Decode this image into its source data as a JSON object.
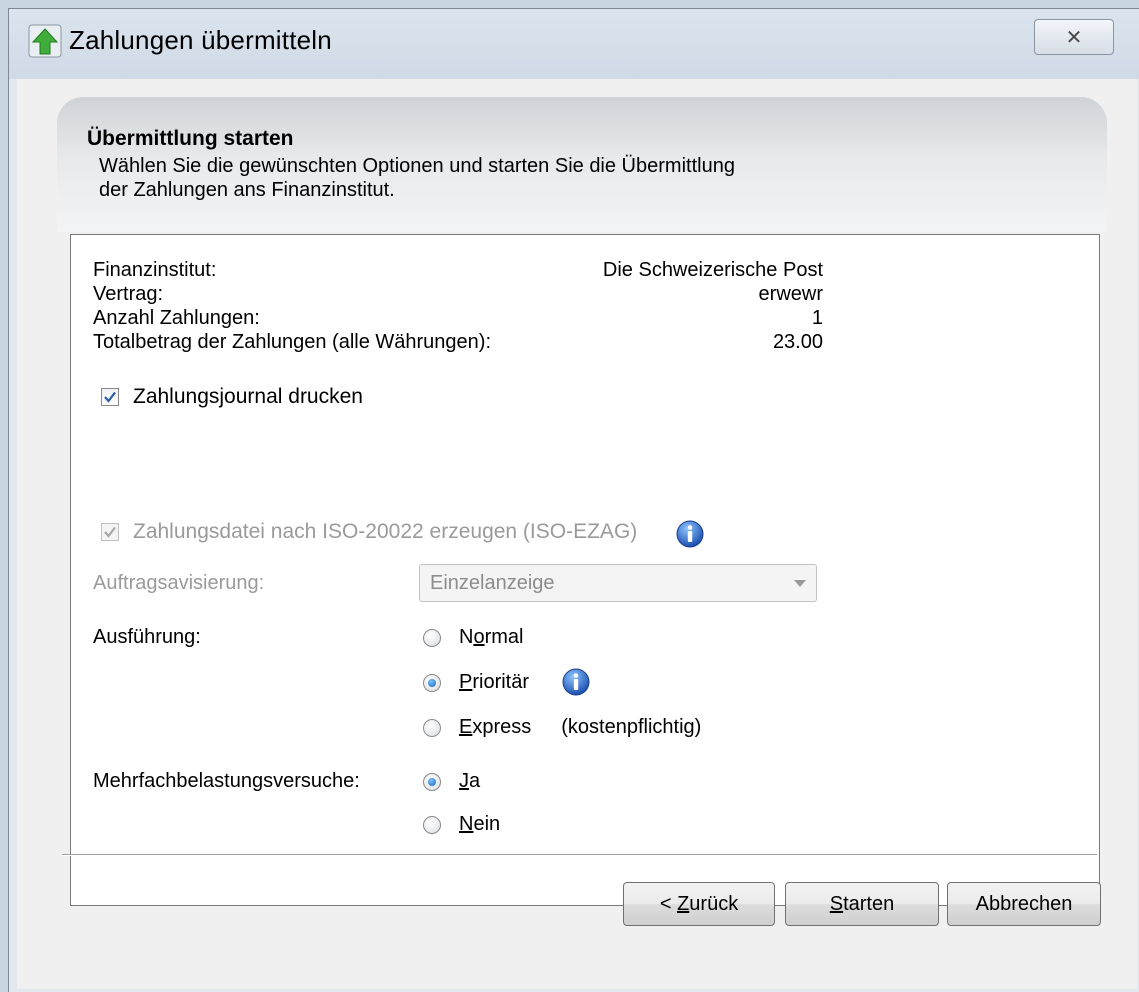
{
  "window": {
    "title": "Zahlungen übermitteln",
    "close_glyph": "✕"
  },
  "header": {
    "title": "Übermittlung starten",
    "description": "Wählen Sie die gewünschten Optionen und starten Sie die Übermittlung\nder Zahlungen ans Finanzinstitut."
  },
  "summary": [
    {
      "label": "Finanzinstitut:",
      "value": "Die Schweizerische Post"
    },
    {
      "label": "Vertrag:",
      "value": "erwewr"
    },
    {
      "label": "Anzahl Zahlungen:",
      "value": "1"
    },
    {
      "label": "Totalbetrag der Zahlungen (alle Währungen):",
      "value": "23.00"
    }
  ],
  "options": {
    "print_journal": {
      "label": "Zahlungsjournal drucken",
      "checked": true
    },
    "iso_file": {
      "label": "Zahlungsdatei nach ISO-20022 erzeugen (ISO-EZAG)",
      "checked": true,
      "enabled": false
    },
    "advice": {
      "label": "Auftragsavisierung:",
      "selected": "Einzelanzeige"
    }
  },
  "execution": {
    "label": "Ausführung:",
    "choices": [
      {
        "prefix": "N",
        "accel": "o",
        "rest": "rmal",
        "selected": false
      },
      {
        "prefix": "",
        "accel": "P",
        "rest": "rioritär",
        "selected": true
      },
      {
        "prefix": "",
        "accel": "E",
        "rest": "xpress",
        "note": "(kostenpflichtig)",
        "selected": false
      }
    ]
  },
  "multi_debit": {
    "label": "Mehrfachbelastungsversuche:",
    "choices": [
      {
        "accel": "J",
        "rest": "a",
        "selected": true
      },
      {
        "accel": "N",
        "rest": "ein",
        "selected": false
      }
    ]
  },
  "buttons": {
    "back": {
      "prefix": "< ",
      "accel": "Z",
      "rest": "urück"
    },
    "start": {
      "accel": "S",
      "rest": "tarten"
    },
    "cancel": {
      "label": "Abbrechen"
    }
  },
  "colors": {
    "accent_radio": "#1463b8",
    "disabled_text": "#9a9a9a",
    "header_gradient_top": "#cfd3d7"
  },
  "icons": [
    "green-up-arrow-icon",
    "close-icon",
    "info-icon",
    "checkbox-check-icon",
    "dropdown-arrow-icon"
  ]
}
